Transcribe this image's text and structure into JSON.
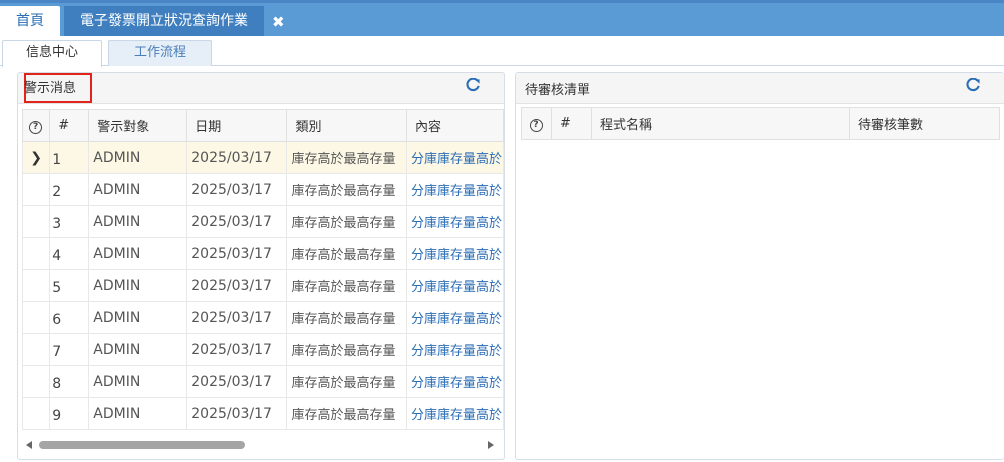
{
  "top_tabs": {
    "home": "首頁",
    "active": "電子發票開立狀況查詢作業",
    "close": "✖"
  },
  "sub_tabs": {
    "info_center": "信息中心",
    "workflow": "工作流程"
  },
  "alerts_panel": {
    "title": "警示消息",
    "refresh_icon": "refresh-icon",
    "columns": {
      "help": "?",
      "num": "#",
      "target": "警示對象",
      "date": "日期",
      "category": "類別",
      "content": "內容"
    },
    "rows": [
      {
        "num": "1",
        "target": "ADMIN",
        "date": "2025/03/17",
        "category": "庫存高於最高存量",
        "content": "分庫庫存量高於"
      },
      {
        "num": "2",
        "target": "ADMIN",
        "date": "2025/03/17",
        "category": "庫存高於最高存量",
        "content": "分庫庫存量高於"
      },
      {
        "num": "3",
        "target": "ADMIN",
        "date": "2025/03/17",
        "category": "庫存高於最高存量",
        "content": "分庫庫存量高於"
      },
      {
        "num": "4",
        "target": "ADMIN",
        "date": "2025/03/17",
        "category": "庫存高於最高存量",
        "content": "分庫庫存量高於"
      },
      {
        "num": "5",
        "target": "ADMIN",
        "date": "2025/03/17",
        "category": "庫存高於最高存量",
        "content": "分庫庫存量高於"
      },
      {
        "num": "6",
        "target": "ADMIN",
        "date": "2025/03/17",
        "category": "庫存高於最高存量",
        "content": "分庫庫存量高於"
      },
      {
        "num": "7",
        "target": "ADMIN",
        "date": "2025/03/17",
        "category": "庫存高於最高存量",
        "content": "分庫庫存量高於"
      },
      {
        "num": "8",
        "target": "ADMIN",
        "date": "2025/03/17",
        "category": "庫存高於最高存量",
        "content": "分庫庫存量高於"
      },
      {
        "num": "9",
        "target": "ADMIN",
        "date": "2025/03/17",
        "category": "庫存高於最高存量",
        "content": "分庫庫存量高於"
      }
    ],
    "selected_row_marker": "❯"
  },
  "pending_panel": {
    "title": "待審核清單",
    "refresh_icon": "refresh-icon",
    "columns": {
      "help": "?",
      "num": "#",
      "program": "程式名稱",
      "count": "待審核筆數"
    }
  },
  "colors": {
    "accent": "#5b9bd5",
    "active_tab": "#3f7fc0",
    "link": "#2a6db5",
    "highlight_box": "#e2231a",
    "selected_row": "#fdf8e6"
  }
}
